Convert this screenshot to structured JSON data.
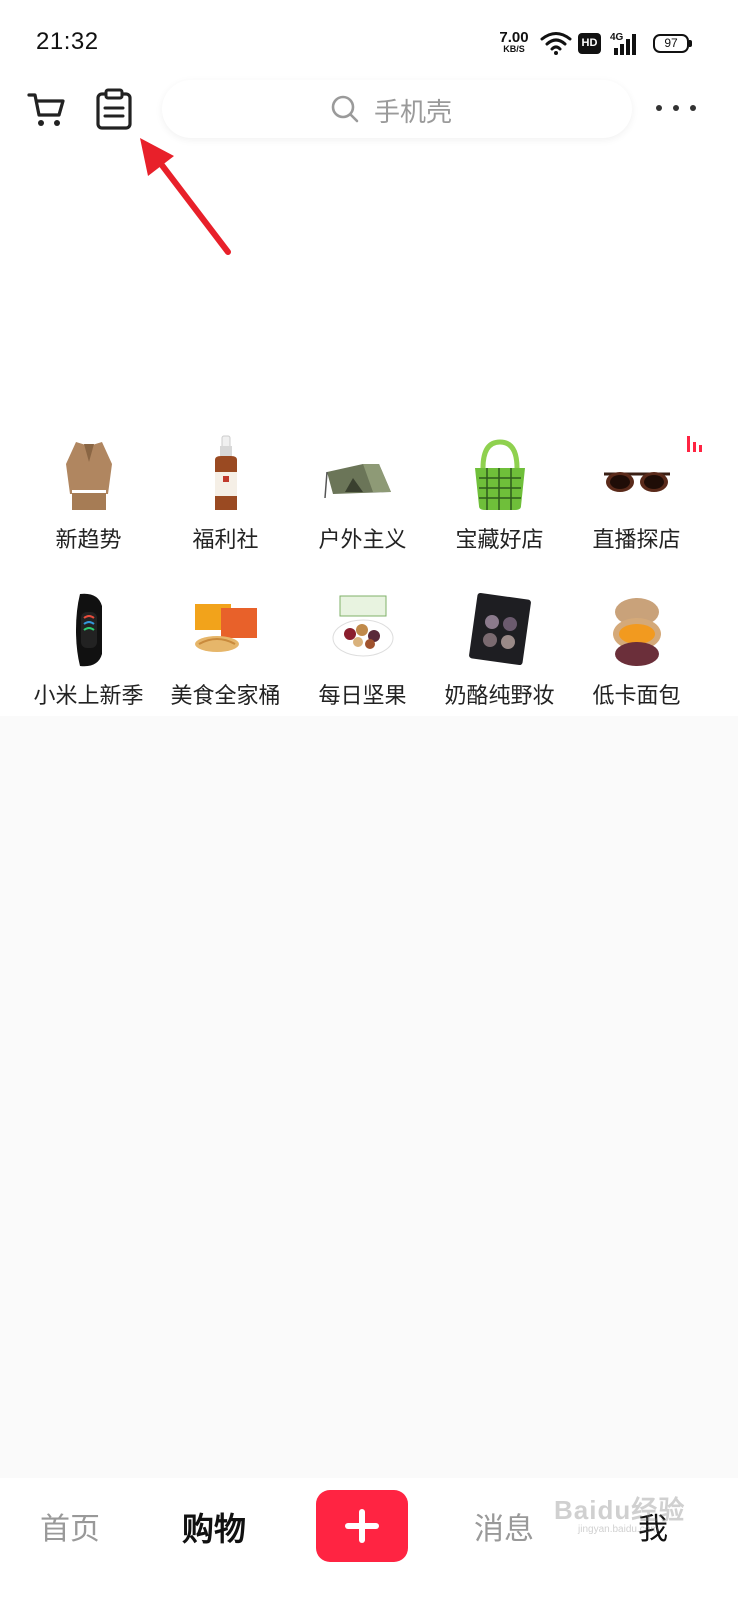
{
  "status_bar": {
    "time": "21:32",
    "net_speed_value": "7.00",
    "net_speed_unit": "KB/S",
    "hd_label": "HD",
    "network_label": "4G",
    "battery": "97"
  },
  "header": {
    "cart_icon": "shopping-cart-icon",
    "clipboard_icon": "clipboard-icon",
    "search_placeholder": "手机壳",
    "more_icon": "more-dots-icon"
  },
  "categories": [
    {
      "label": "新趋势",
      "icon": "jacket-outfit-image"
    },
    {
      "label": "福利社",
      "icon": "serum-bottle-image"
    },
    {
      "label": "户外主义",
      "icon": "tent-image"
    },
    {
      "label": "宝藏好店",
      "icon": "green-handbag-image"
    },
    {
      "label": "直播探店",
      "icon": "sunglasses-image"
    },
    {
      "label": "小米上新季",
      "icon": "smart-band-image"
    },
    {
      "label": "美食全家桶",
      "icon": "snack-box-image"
    },
    {
      "label": "每日坚果",
      "icon": "nuts-bowl-image"
    },
    {
      "label": "奶酪纯野妆",
      "icon": "eyeshadow-palette-image"
    },
    {
      "label": "低卡面包",
      "icon": "bread-image"
    }
  ],
  "bottom_nav": {
    "home": "首页",
    "shop": "购物",
    "add_icon": "plus-icon",
    "messages": "消息",
    "me": "我"
  },
  "watermark": {
    "text": "Baidu经验",
    "url": "jingyan.baidu.com"
  },
  "colors": {
    "accent": "#ff2442",
    "annotation_arrow": "#e8202a",
    "background": "#ffffff",
    "content_bg": "#fafafa"
  }
}
